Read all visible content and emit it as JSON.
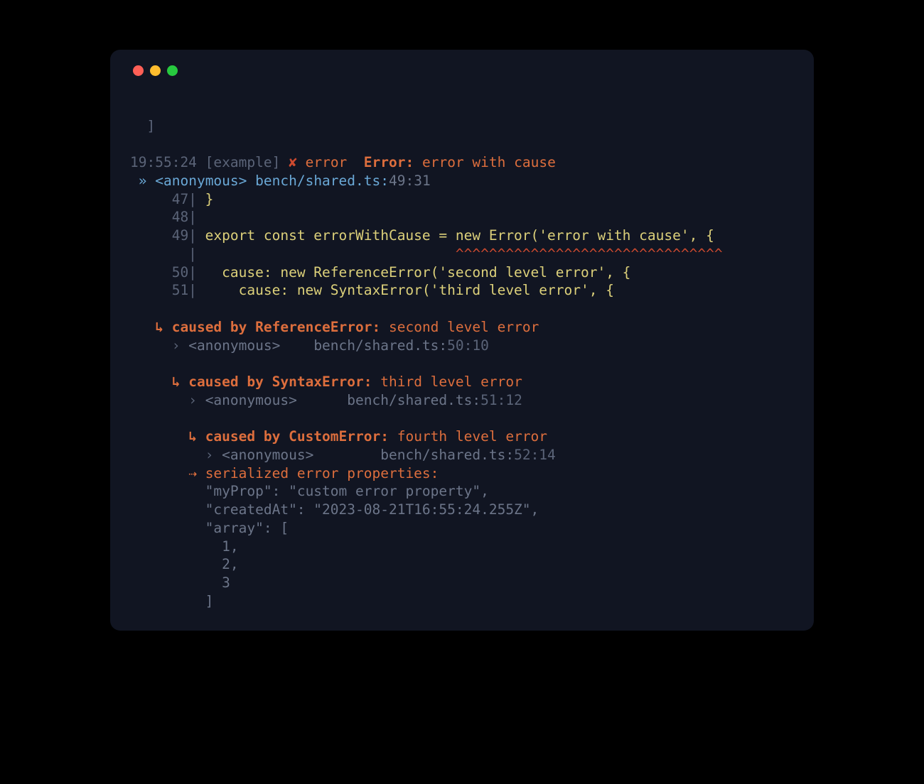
{
  "top_bracket": "  ]",
  "log": {
    "timestamp": "19:55:24",
    "scope": "[example]",
    "x_mark": "✘",
    "level": "error",
    "error_label": "Error:",
    "error_message": "error with cause"
  },
  "frame": {
    "arrow": "»",
    "anon": "<anonymous>",
    "path": "bench/shared.ts:",
    "line": "49",
    "col": ":31"
  },
  "code": {
    "l47_num": "47|",
    "l47": " }",
    "l48_num": "48|",
    "l48": "",
    "l49_num": "49|",
    "l49": " export const errorWithCause = new Error('error with cause', {",
    "sq_num": "  |",
    "sq_pad": "                               ",
    "sq": "^^^^^^^^^^^^^^^^^^^^^^^^^^^^^^^^",
    "l50_num": "50|",
    "l50": "   cause: new ReferenceError('second level error', {",
    "l51_num": "51|",
    "l51": "     cause: new SyntaxError('third level error', {"
  },
  "cause1": {
    "arrow": "↳",
    "label": "caused by ReferenceError:",
    "message": "second level error",
    "frame_arrow": "›",
    "anon": "<anonymous>",
    "path": "bench/shared.ts:",
    "line": "50",
    "col": ":10"
  },
  "cause2": {
    "arrow": "↳",
    "label": "caused by SyntaxError:",
    "message": "third level error",
    "frame_arrow": "›",
    "anon": "<anonymous>",
    "path": "bench/shared.ts:",
    "line": "51",
    "col": ":12"
  },
  "cause3": {
    "arrow": "↳",
    "label": "caused by CustomError:",
    "message": "fourth level error",
    "frame_arrow": "›",
    "anon": "<anonymous>",
    "path": "bench/shared.ts:",
    "line": "52",
    "col": ":14"
  },
  "serial": {
    "arrow": "⇢",
    "label": "serialized error properties:",
    "p1k": "\"myProp\":",
    "p1v": " \"custom error property\",",
    "p2k": "\"createdAt\":",
    "p2v": " \"2023-08-21T16:55:24.255Z\",",
    "p3k": "\"array\":",
    "p3v": " [",
    "arr1": "  1,",
    "arr2": "  2,",
    "arr3": "  3",
    "close": "]"
  }
}
